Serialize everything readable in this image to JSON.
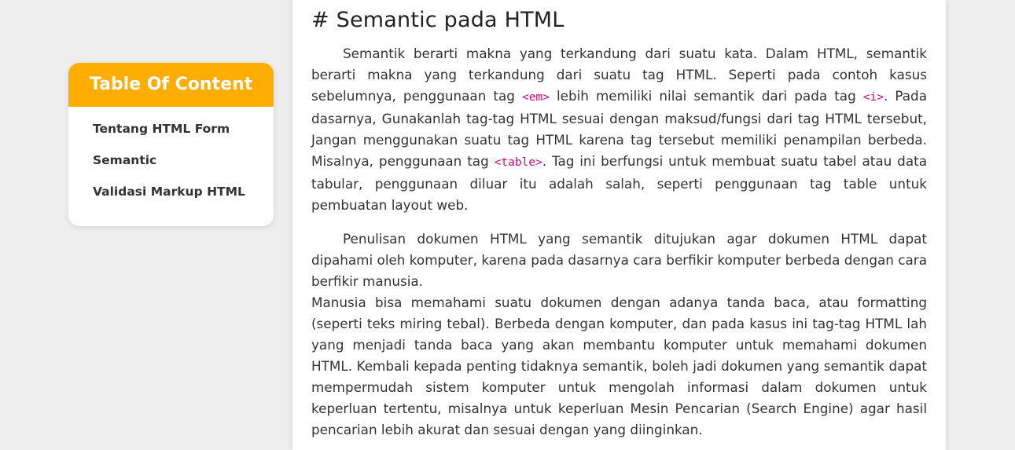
{
  "toc": {
    "title": "Table Of Content",
    "items": [
      {
        "label": "Tentang HTML Form"
      },
      {
        "label": "Semantic"
      },
      {
        "label": "Validasi Markup HTML"
      }
    ]
  },
  "article": {
    "heading": "# Semantic pada HTML",
    "para1": {
      "t1": "Semantik berarti makna yang terkandung dari suatu kata. Dalam HTML, semantik berarti makna yang terkandung dari suatu tag HTML. Seperti pada contoh kasus sebelumnya, penggunaan tag ",
      "code1": "<em>",
      "t2": " lebih memiliki nilai semantik dari pada tag ",
      "code2": "<i>",
      "t3": ". Pada dasarnya, Gunakanlah tag-tag HTML sesuai dengan maksud/fungsi dari tag HTML tersebut, Jangan menggunakan suatu tag HTML karena tag tersebut memiliki penampilan berbeda. Misalnya, penggunaan tag ",
      "code3": "<table>",
      "t4": ". Tag ini berfungsi untuk membuat suatu tabel atau data tabular, penggunaan diluar itu adalah salah, seperti penggunaan tag table untuk pembuatan layout web."
    },
    "para2": "Penulisan dokumen HTML yang semantik ditujukan agar dokumen HTML dapat dipahami oleh komputer, karena pada dasarnya cara berfikir komputer berbeda dengan cara berfikir manusia.",
    "para3": "Manusia bisa memahami suatu dokumen dengan adanya tanda baca, atau formatting (seperti teks miring tebal). Berbeda dengan komputer, dan pada kasus ini tag-tag HTML lah yang menjadi tanda baca yang akan membantu komputer untuk memahami dokumen HTML. Kembali kepada penting tidaknya semantik, boleh jadi dokumen yang semantik dapat mempermudah sistem komputer untuk mengolah informasi dalam dokumen untuk keperluan tertentu, misalnya untuk keperluan Mesin Pencarian (Search Engine) agar hasil pencarian lebih akurat dan sesuai dengan yang diinginkan."
  },
  "colors": {
    "accent": "#ffad00",
    "code": "#c7097f",
    "background": "#eeeeee"
  }
}
